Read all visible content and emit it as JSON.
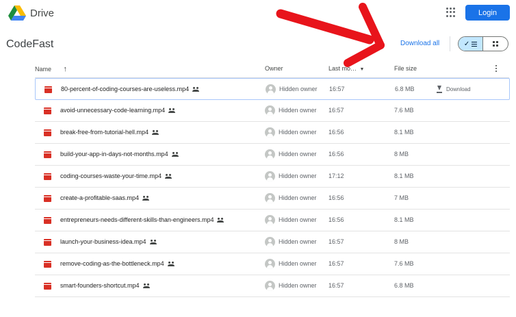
{
  "app": {
    "brand": "Drive",
    "login_label": "Login",
    "apps_icon": "apps-grid-icon"
  },
  "folder": {
    "title": "CodeFast",
    "download_all_label": "Download all",
    "view": "list"
  },
  "columns": {
    "name": "Name",
    "sort_icon": "↑",
    "owner": "Owner",
    "modified": "Last mo…",
    "size": "File size"
  },
  "files": [
    {
      "name": "80-percent-of-coding-courses-are-useless.mp4",
      "owner": "Hidden owner",
      "modified": "16:57",
      "size": "6.8 MB",
      "action": "Download"
    },
    {
      "name": "avoid-unnecessary-code-learning.mp4",
      "owner": "Hidden owner",
      "modified": "16:57",
      "size": "7.6 MB"
    },
    {
      "name": "break-free-from-tutorial-hell.mp4",
      "owner": "Hidden owner",
      "modified": "16:56",
      "size": "8.1 MB"
    },
    {
      "name": "build-your-app-in-days-not-months.mp4",
      "owner": "Hidden owner",
      "modified": "16:56",
      "size": "8 MB"
    },
    {
      "name": "coding-courses-waste-your-time.mp4",
      "owner": "Hidden owner",
      "modified": "17:12",
      "size": "8.1 MB"
    },
    {
      "name": "create-a-profitable-saas.mp4",
      "owner": "Hidden owner",
      "modified": "16:56",
      "size": "7 MB"
    },
    {
      "name": "entrepreneurs-needs-different-skills-than-engineers.mp4",
      "owner": "Hidden owner",
      "modified": "16:56",
      "size": "8.1 MB"
    },
    {
      "name": "launch-your-business-idea.mp4",
      "owner": "Hidden owner",
      "modified": "16:57",
      "size": "8 MB"
    },
    {
      "name": "remove-coding-as-the-bottleneck.mp4",
      "owner": "Hidden owner",
      "modified": "16:57",
      "size": "7.6 MB"
    },
    {
      "name": "smart-founders-shortcut.mp4",
      "owner": "Hidden owner",
      "modified": "16:57",
      "size": "6.8 MB"
    }
  ],
  "colors": {
    "accent": "#1a73e8",
    "annotation_arrow": "#e8141b",
    "file_icon": "#d93025"
  }
}
